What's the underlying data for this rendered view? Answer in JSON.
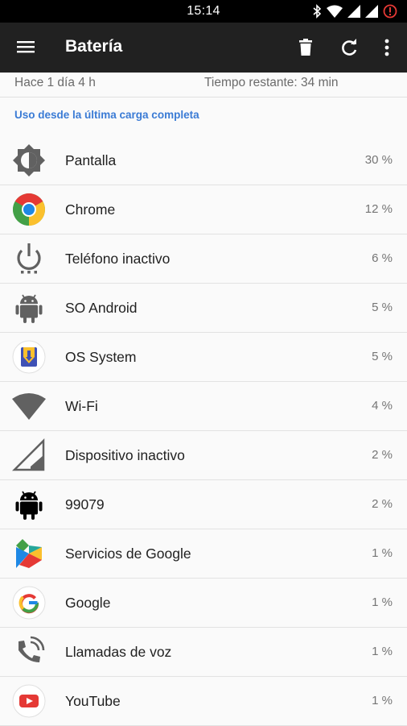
{
  "status_bar": {
    "time": "15:14",
    "icons": [
      "bluetooth-icon",
      "wifi-icon",
      "signal-icon",
      "signal-icon",
      "alert-icon"
    ]
  },
  "app_bar": {
    "title": "Batería",
    "actions": [
      "menu-icon",
      "trash-icon",
      "refresh-icon",
      "more-vert-icon"
    ]
  },
  "summary": {
    "since": "Hace 1 día 4 h",
    "remaining": "Tiempo restante: 34 min"
  },
  "section_title": "Uso desde la última carga completa",
  "usage": [
    {
      "name": "Pantalla",
      "percent": "30 %",
      "icon": "brightness-icon"
    },
    {
      "name": "Chrome",
      "percent": "12 %",
      "icon": "chrome-icon"
    },
    {
      "name": "Teléfono inactivo",
      "percent": "6 %",
      "icon": "power-icon"
    },
    {
      "name": "SO Android",
      "percent": "5 %",
      "icon": "android-icon"
    },
    {
      "name": "OS System",
      "percent": "5 %",
      "icon": "os-system-icon"
    },
    {
      "name": "Wi-Fi",
      "percent": "4 %",
      "icon": "wifi-icon"
    },
    {
      "name": "Dispositivo inactivo",
      "percent": "2 %",
      "icon": "cell-signal-icon"
    },
    {
      "name": "99079",
      "percent": "2 %",
      "icon": "android-icon"
    },
    {
      "name": "Servicios de Google",
      "percent": "1 %",
      "icon": "play-services-icon"
    },
    {
      "name": "Google",
      "percent": "1 %",
      "icon": "google-icon"
    },
    {
      "name": "Llamadas de voz",
      "percent": "1 %",
      "icon": "phone-call-icon"
    },
    {
      "name": "YouTube",
      "percent": "1 %",
      "icon": "youtube-icon"
    }
  ],
  "colors": {
    "app_bar": "#212121",
    "accent": "#3a7bd5",
    "background": "#fafafa"
  }
}
